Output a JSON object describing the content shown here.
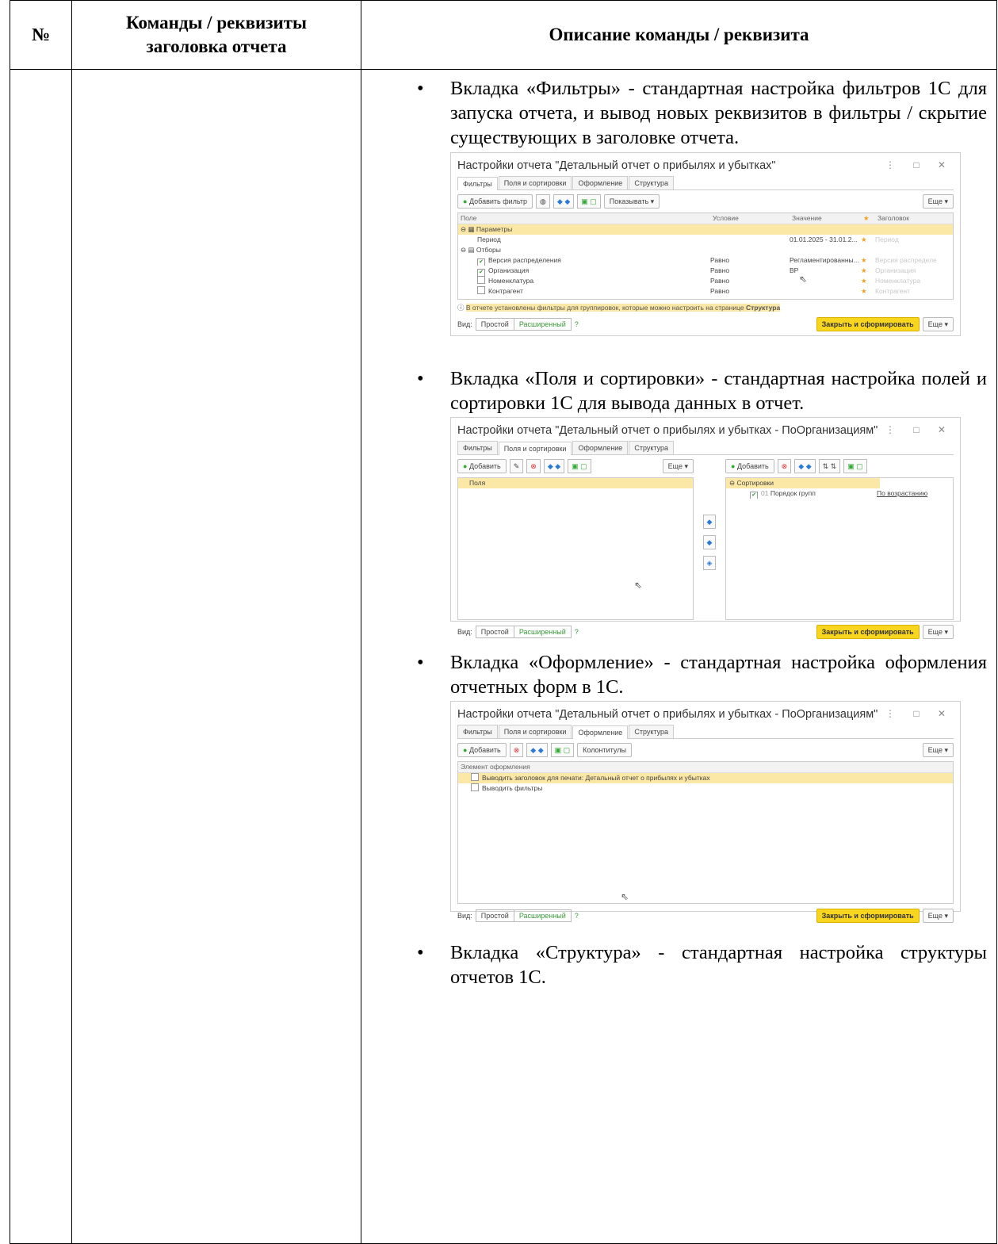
{
  "table": {
    "header": {
      "col1": "№",
      "col2": "Команды / реквизиты заголовка отчета",
      "col3": "Описание команды / реквизита"
    }
  },
  "bullets": [
    {
      "text": "Вкладка «Фильтры» - стандартная настройка фильтров 1С для запуска отчета, и вывод новых реквизитов в фильтры / скрытие существующих в заголовке отчета."
    },
    {
      "text": "Вкладка «Поля и сортировки» - стандартная настройка полей и сортировки 1С для вывода данных в отчет."
    },
    {
      "text": "Вкладка «Оформление» - стандартная настройка оформления отчетных форм в 1С."
    },
    {
      "text": "Вкладка «Структура» - стандартная настройка структуры отчетов 1С."
    }
  ],
  "common": {
    "tabs": [
      "Фильтры",
      "Поля и сортировки",
      "Оформление",
      "Структура"
    ],
    "view_label": "Вид:",
    "view_simple": "Простой",
    "view_extended": "Расширенный",
    "help": "?",
    "close_and_generate": "Закрыть и сформировать",
    "more": "Еще ▾",
    "win_controls": "⋮ □ ✕"
  },
  "shot1": {
    "title": "Настройки отчета \"Детальный отчет о прибылях и убытках\"",
    "add_filter": "Добавить фильтр",
    "show": "Показывать ▾",
    "columns": [
      "Поле",
      "Условие",
      "Значение",
      "★",
      "Заголовок"
    ],
    "rows": [
      {
        "field": "Параметры",
        "cond": "",
        "val": "",
        "star": "",
        "hdr": ""
      },
      {
        "field": "Период",
        "cond": "",
        "val": "01.01.2025 - 31.01.2...",
        "star": "★",
        "hdr": "Период"
      },
      {
        "field": "Отборы",
        "cond": "",
        "val": "",
        "star": "",
        "hdr": ""
      },
      {
        "field": "Версия распределения",
        "cond": "Равно",
        "val": "Регламентированны...",
        "star": "★",
        "hdr": "Версия распределе"
      },
      {
        "field": "Организация",
        "cond": "Равно",
        "val": "ВР",
        "star": "★",
        "hdr": "Организация"
      },
      {
        "field": "Номенклатура",
        "cond": "Равно",
        "val": "",
        "star": "★",
        "hdr": "Номенклатура"
      },
      {
        "field": "Контрагент",
        "cond": "Равно",
        "val": "",
        "star": "★",
        "hdr": "Контрагент"
      }
    ],
    "info_prefix": "В отчете установлены фильтры для группировок, которые можно настроить на странице ",
    "info_link": "Структура"
  },
  "shot2": {
    "title": "Настройки отчета \"Детальный отчет о прибылях и убытках - ПоОрганизациям\"",
    "add": "Добавить",
    "fields_label": "Поля",
    "sorts_label": "Сортировки",
    "sort_num": "01",
    "sort_item": "Порядок групп",
    "sort_dir": "По возрастанию"
  },
  "shot3": {
    "title": "Настройки отчета \"Детальный отчет о прибылях и убытках - ПоОрганизациям\"",
    "add": "Добавить",
    "headers_footers": "Колонтитулы",
    "col_header": "Элемент оформления",
    "items": [
      "Выводить заголовок для печати: Детальный отчет о прибылях и убытках",
      "Выводить фильтры"
    ]
  }
}
